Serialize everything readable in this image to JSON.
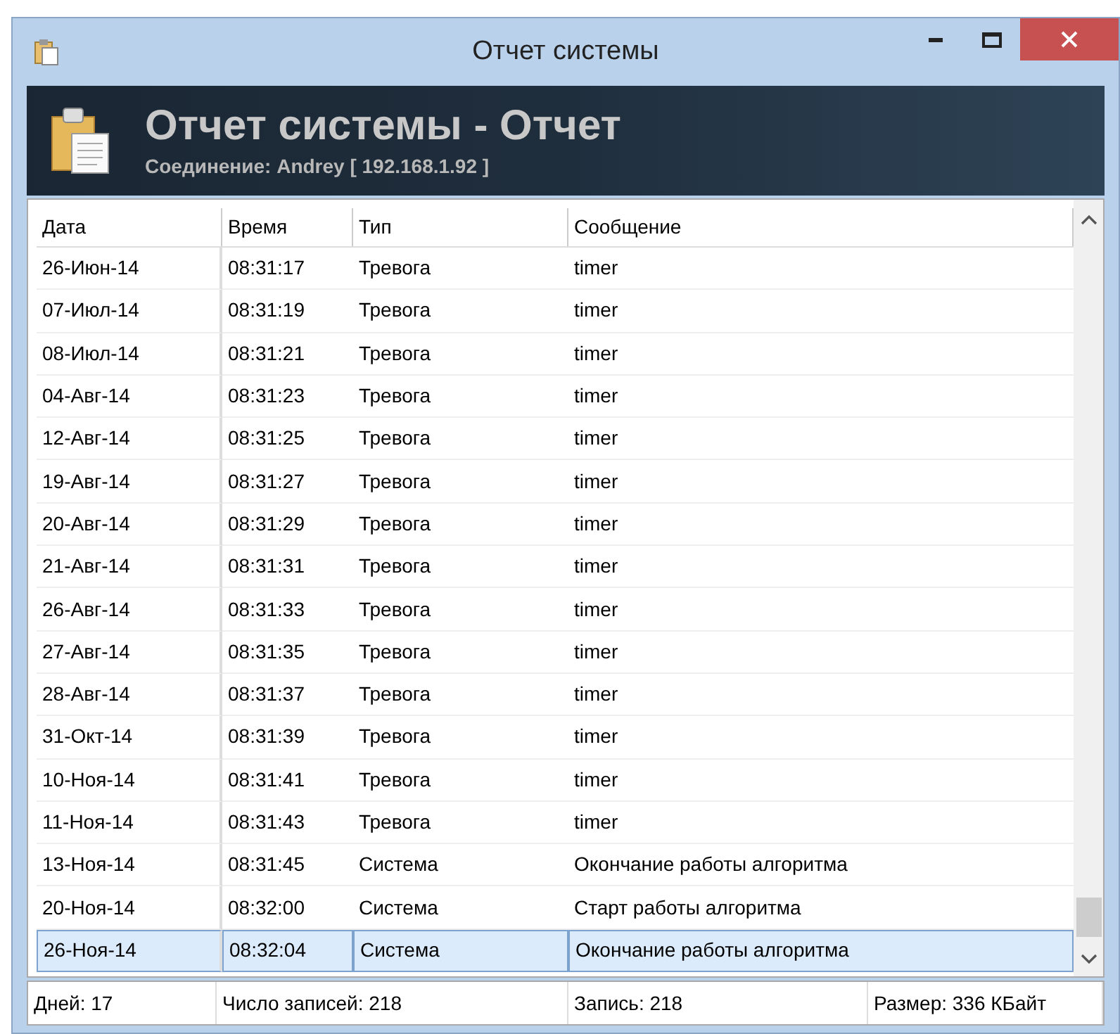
{
  "window": {
    "title": "Отчет системы"
  },
  "header": {
    "title": "Отчет системы - Отчет",
    "subtitle": "Соединение: Andrey [ 192.168.1.92 ]"
  },
  "table": {
    "columns": [
      "Дата",
      "Время",
      "Тип",
      "Сообщение"
    ],
    "rows": [
      {
        "cells": [
          "26-Июн-14",
          "08:31:17",
          "Тревога",
          "timer"
        ],
        "selected": false
      },
      {
        "cells": [
          "07-Июл-14",
          "08:31:19",
          "Тревога",
          "timer"
        ],
        "selected": false
      },
      {
        "cells": [
          "08-Июл-14",
          "08:31:21",
          "Тревога",
          "timer"
        ],
        "selected": false
      },
      {
        "cells": [
          "04-Авг-14",
          "08:31:23",
          "Тревога",
          "timer"
        ],
        "selected": false
      },
      {
        "cells": [
          "12-Авг-14",
          "08:31:25",
          "Тревога",
          "timer"
        ],
        "selected": false
      },
      {
        "cells": [
          "19-Авг-14",
          "08:31:27",
          "Тревога",
          "timer"
        ],
        "selected": false
      },
      {
        "cells": [
          "20-Авг-14",
          "08:31:29",
          "Тревога",
          "timer"
        ],
        "selected": false
      },
      {
        "cells": [
          "21-Авг-14",
          "08:31:31",
          "Тревога",
          "timer"
        ],
        "selected": false
      },
      {
        "cells": [
          "26-Авг-14",
          "08:31:33",
          "Тревога",
          "timer"
        ],
        "selected": false
      },
      {
        "cells": [
          "27-Авг-14",
          "08:31:35",
          "Тревога",
          "timer"
        ],
        "selected": false
      },
      {
        "cells": [
          "28-Авг-14",
          "08:31:37",
          "Тревога",
          "timer"
        ],
        "selected": false
      },
      {
        "cells": [
          "31-Окт-14",
          "08:31:39",
          "Тревога",
          "timer"
        ],
        "selected": false
      },
      {
        "cells": [
          "10-Ноя-14",
          "08:31:41",
          "Тревога",
          "timer"
        ],
        "selected": false
      },
      {
        "cells": [
          "11-Ноя-14",
          "08:31:43",
          "Тревога",
          "timer"
        ],
        "selected": false
      },
      {
        "cells": [
          "13-Ноя-14",
          "08:31:45",
          "Система",
          "Окончание работы алгоритма"
        ],
        "selected": false
      },
      {
        "cells": [
          "20-Ноя-14",
          "08:32:00",
          "Система",
          "Старт работы алгоритма"
        ],
        "selected": false
      },
      {
        "cells": [
          "26-Ноя-14",
          "08:32:04",
          "Система",
          "Окончание работы алгоритма"
        ],
        "selected": true
      }
    ]
  },
  "status_bar": [
    "Дней: 17",
    "Число записей: 218",
    "Запись: 218",
    "Размер: 336 КБайт"
  ]
}
